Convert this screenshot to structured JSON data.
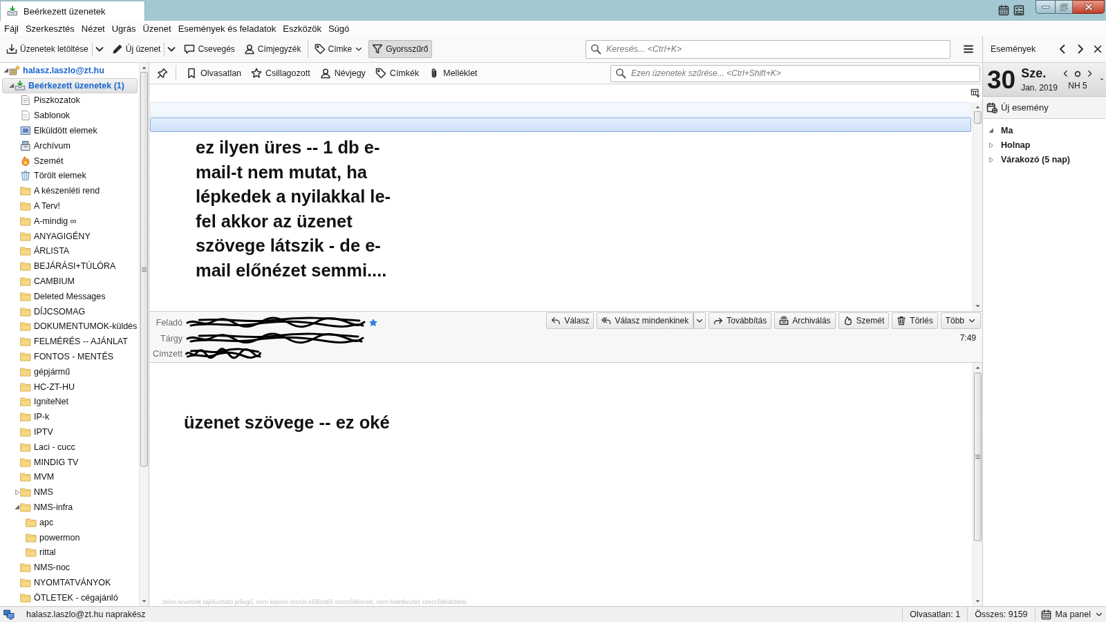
{
  "window": {
    "tab": {
      "title": "Beérkezett üzenetek",
      "selected": true
    }
  },
  "menu": [
    "Fájl",
    "Szerkesztés",
    "Nézet",
    "Ugrás",
    "Üzenet",
    "Események és feladatok",
    "Eszközök",
    "Súgó"
  ],
  "toolbar": {
    "groups": [
      [
        {
          "label": "Üzenetek letöltése",
          "kind": "split",
          "pressed": false
        },
        {
          "label": "Új üzenet",
          "kind": "split",
          "pressed": false
        },
        {
          "label": "Csevegés",
          "kind": "button",
          "pressed": false
        },
        {
          "label": "Címjegyzék",
          "kind": "button",
          "pressed": false
        }
      ],
      [
        {
          "label": "Címke",
          "kind": "menu",
          "pressed": false
        },
        {
          "label": "Gyorsszűrő",
          "kind": "button",
          "pressed": true
        }
      ]
    ],
    "search": {
      "placeholder": "Keresés... <Ctrl+K>"
    }
  },
  "folder_tree": [
    {
      "name": "halasz.laszlo@zt.hu",
      "kind": "account",
      "selected": false,
      "expanded": true,
      "children": [
        {
          "name": "Beérkezett üzenetek (1)",
          "kind": "inbox",
          "selected": true,
          "expanded": true,
          "children": [
            {
              "name": "Piszkozatok",
              "kind": "drafts",
              "selected": false
            },
            {
              "name": "Sablonok",
              "kind": "templates",
              "selected": false
            },
            {
              "name": "Elküldött elemek",
              "kind": "sent",
              "selected": false
            },
            {
              "name": "Archívum",
              "kind": "archive",
              "selected": false
            },
            {
              "name": "Szemét",
              "kind": "junk",
              "selected": false
            },
            {
              "name": "Törölt elemek",
              "kind": "trash",
              "selected": false
            },
            {
              "name": "A készenléti rend",
              "kind": "folder",
              "selected": false
            },
            {
              "name": "A Terv!",
              "kind": "folder",
              "selected": false
            },
            {
              "name": "A-mindig ∞",
              "kind": "folder",
              "selected": false
            },
            {
              "name": "ANYAGIGÉNY",
              "kind": "folder",
              "selected": false
            },
            {
              "name": "ÁRLISTA",
              "kind": "folder",
              "selected": false
            },
            {
              "name": "BEJÁRÁSI+TÚLÓRA",
              "kind": "folder",
              "selected": false
            },
            {
              "name": "CAMBIUM",
              "kind": "folder",
              "selected": false
            },
            {
              "name": "Deleted Messages",
              "kind": "folder",
              "selected": false
            },
            {
              "name": "DÍJCSOMAG",
              "kind": "folder",
              "selected": false
            },
            {
              "name": "DOKUMENTUMOK-küldés",
              "kind": "folder",
              "selected": false
            },
            {
              "name": "FELMÉRÉS -- AJÁNLAT",
              "kind": "folder",
              "selected": false
            },
            {
              "name": "FONTOS - MENTÉS",
              "kind": "folder",
              "selected": false
            },
            {
              "name": "gépjármű",
              "kind": "folder",
              "selected": false
            },
            {
              "name": "HC-ZT-HU",
              "kind": "folder",
              "selected": false
            },
            {
              "name": "IgniteNet",
              "kind": "folder",
              "selected": false
            },
            {
              "name": "IP-k",
              "kind": "folder",
              "selected": false
            },
            {
              "name": "IPTV",
              "kind": "folder",
              "selected": false
            },
            {
              "name": "Laci - cucc",
              "kind": "folder",
              "selected": false
            },
            {
              "name": "MINDIG TV",
              "kind": "folder",
              "selected": false
            },
            {
              "name": "MVM",
              "kind": "folder",
              "selected": false
            },
            {
              "name": "NMS",
              "kind": "folder",
              "selected": false,
              "expanded": false
            },
            {
              "name": "NMS-infra",
              "kind": "folder",
              "selected": false,
              "expanded": true,
              "children": [
                {
                  "name": "apc",
                  "kind": "folder",
                  "selected": false
                },
                {
                  "name": "powermon",
                  "kind": "folder",
                  "selected": false
                },
                {
                  "name": "rittal",
                  "kind": "folder",
                  "selected": false
                }
              ]
            },
            {
              "name": "NMS-noc",
              "kind": "folder",
              "selected": false
            },
            {
              "name": "NYOMTATVÁNYOK",
              "kind": "folder",
              "selected": false
            },
            {
              "name": "ÖTLETEK - cégajánló",
              "kind": "folder",
              "selected": false
            }
          ]
        }
      ]
    }
  ],
  "quick_filter": {
    "toggles": [
      {
        "label": "Olvasatlan",
        "on": false
      },
      {
        "label": "Csillagozott",
        "on": false
      },
      {
        "label": "Névjegy",
        "on": false
      },
      {
        "label": "Címkék",
        "on": false
      },
      {
        "label": "Melléklet",
        "on": false
      }
    ],
    "placeholder": "Ezen üzenetek szűrése... <Ctrl+Shift+K>"
  },
  "message_list": {
    "rows": [
      {
        "selected": false,
        "hovered": true
      },
      {
        "selected": true,
        "hovered": false
      }
    ]
  },
  "annotation": "ez ilyen üres -- 1 db e-mail-t nem mutat, ha lépkedek a nyilakkal le-fel akkor az üzenet szövege látszik - de e-mail előnézet semmi....",
  "message_header": {
    "fields": [
      {
        "label": "Feladó",
        "redacted": true
      },
      {
        "label": "Tárgy",
        "redacted": true
      },
      {
        "label": "Címzett",
        "redacted": true
      }
    ],
    "buttons": [
      {
        "label": "Válasz",
        "kind": "button"
      },
      {
        "label": "Válasz mindenkinek",
        "kind": "split"
      },
      {
        "label": "Továbbítás",
        "kind": "button"
      },
      {
        "label": "Archiválás",
        "kind": "button"
      },
      {
        "label": "Szemét",
        "kind": "button"
      },
      {
        "label": "Törlés",
        "kind": "button"
      },
      {
        "label": "Több",
        "kind": "menu"
      }
    ],
    "time": "7:49"
  },
  "message_body": {
    "text": "üzenet szövege -- ez oké",
    "footer": "Jelen levelünk tájékoztató jellegű, nem képezi részét előfizetői szerződésnek, nem keletkeztet szerződéskötési"
  },
  "today_pane": {
    "title": "Események",
    "day": "30",
    "weekday": "Sze.",
    "month_year": "Jan. 2019",
    "week": "NH 5",
    "new_event": "Új esemény",
    "groups": [
      {
        "label": "Ma",
        "expanded": true
      },
      {
        "label": "Holnap",
        "expanded": false
      },
      {
        "label": "Várakozó (5 nap)",
        "expanded": false
      }
    ]
  },
  "status_bar": {
    "account_status": "halasz.laszlo@zt.hu naprakész",
    "unread": "Olvasatlan: 1",
    "total": "Összes: 9159",
    "today_pane_toggle": "Ma panel"
  }
}
